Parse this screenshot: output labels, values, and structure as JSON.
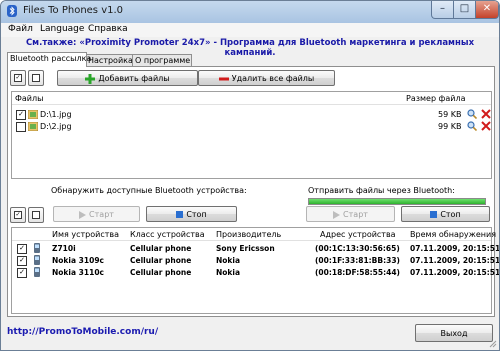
{
  "window": {
    "title": "Files To Phones v1.0",
    "minimize": "–",
    "maximize": "□",
    "close": "✕"
  },
  "menu": [
    "Файл",
    "Language",
    "Справка"
  ],
  "promo": "См.также: «Proximity Promoter 24x7» - Программа для Bluetooth маркетинга и рекламных кампаний.",
  "tabs": [
    "Bluetooth рассылка",
    "Настройка",
    "О программе"
  ],
  "files": {
    "add_label": "Добавить файлы",
    "remove_label": "Удалить все файлы",
    "headers": {
      "name": "Файлы",
      "size": "Размер файла"
    },
    "rows": [
      {
        "checked": true,
        "name": "D:\\1.jpg",
        "size": "59 KB"
      },
      {
        "checked": false,
        "name": "D:\\2.jpg",
        "size": "99 KB"
      }
    ]
  },
  "discover": {
    "label": "Обнаружить доступные Bluetooth устройства:",
    "start": "Старт",
    "stop": "Стоп"
  },
  "send": {
    "label": "Отправить файлы через Bluetooth:",
    "start": "Старт",
    "stop": "Стоп",
    "progress": 1.0
  },
  "devices": {
    "headers": [
      "Имя устройства",
      "Класс устройства",
      "Производитель",
      "Адрес устройства",
      "Время обнаружения"
    ],
    "rows": [
      {
        "checked": true,
        "name": "Z710i",
        "class": "Cellular phone",
        "maker": "Sony Ericsson",
        "address": "(00:1C:13:30:56:65)",
        "time": "07.11.2009, 20:15:51"
      },
      {
        "checked": true,
        "name": "Nokia 3109c",
        "class": "Cellular phone",
        "maker": "Nokia",
        "address": "(00:1F:33:81:BB:33)",
        "time": "07.11.2009, 20:15:51"
      },
      {
        "checked": true,
        "name": "Nokia 3110c",
        "class": "Cellular phone",
        "maker": "Nokia",
        "address": "(00:18:DF:58:55:44)",
        "time": "07.11.2009, 20:15:51"
      }
    ]
  },
  "footer": {
    "url": "http://PromoToMobile.com/ru/",
    "exit_label": "Выход"
  },
  "colors": {
    "accent": "#1a1aa8",
    "progress": "#2fb12f",
    "delete": "#d11b1b"
  }
}
